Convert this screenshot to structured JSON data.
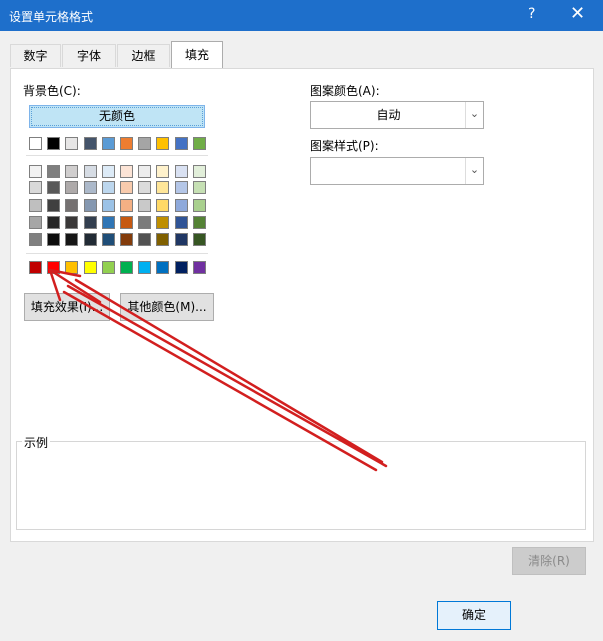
{
  "window": {
    "title": "设置单元格格式",
    "help": "?",
    "close": "✕"
  },
  "tabs": [
    {
      "label": "数字"
    },
    {
      "label": "字体"
    },
    {
      "label": "边框"
    },
    {
      "label": "填充"
    }
  ],
  "fill": {
    "background_label": "背景色(C):",
    "no_color": "无颜色",
    "fill_effects": "填充效果(I)...",
    "more_colors": "其他颜色(M)...",
    "pattern_color_label": "图案颜色(A):",
    "pattern_color_value": "自动",
    "pattern_style_label": "图案样式(P):",
    "pattern_style_value": "",
    "sample_label": "示例",
    "clear": "清除(R)",
    "ok": "确定"
  },
  "colors": {
    "theme_row": [
      "#ffffff",
      "#000000",
      "#e7e6e6",
      "#44546a",
      "#5b9bd5",
      "#ed7d31",
      "#a5a5a5",
      "#ffc000",
      "#4472c4",
      "#70ad47"
    ],
    "shades": [
      [
        "#f2f2f2",
        "#7f7f7f",
        "#d0cece",
        "#d6dce4",
        "#ddebf7",
        "#fce4d6",
        "#ededed",
        "#fff2cc",
        "#d9e1f2",
        "#e2efda"
      ],
      [
        "#d9d9d9",
        "#595959",
        "#aeaaaa",
        "#acb9ca",
        "#bdd7ee",
        "#f8cbad",
        "#dbdbdb",
        "#ffe699",
        "#b4c6e7",
        "#c6e0b4"
      ],
      [
        "#bfbfbf",
        "#404040",
        "#757171",
        "#8497b0",
        "#9bc2e6",
        "#f4b084",
        "#c9c9c9",
        "#ffd966",
        "#8ea9db",
        "#a9d08e"
      ],
      [
        "#a6a6a6",
        "#262626",
        "#3a3838",
        "#333f4f",
        "#2f75b5",
        "#c65911",
        "#7b7b7b",
        "#bf8f00",
        "#305496",
        "#548235"
      ],
      [
        "#808080",
        "#0d0d0d",
        "#161616",
        "#222b35",
        "#1f4e78",
        "#833c0b",
        "#525252",
        "#806000",
        "#203764",
        "#375623"
      ]
    ],
    "standard_row": [
      "#c00000",
      "#ff0000",
      "#ffc000",
      "#ffff00",
      "#92d050",
      "#00b050",
      "#00b0f0",
      "#0070c0",
      "#002060",
      "#7030a0"
    ],
    "annotation_arrow": "#d21f1f"
  }
}
